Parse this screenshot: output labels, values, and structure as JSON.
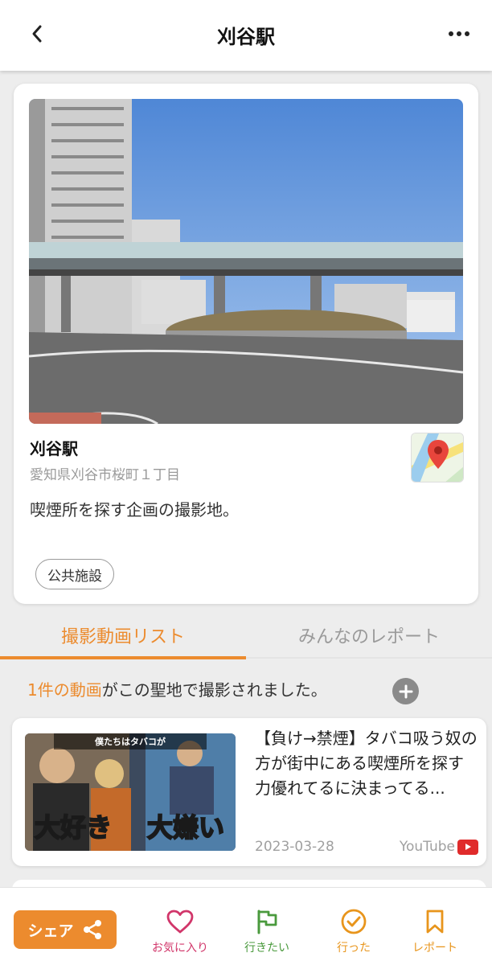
{
  "header": {
    "title": "刈谷駅",
    "back_icon": "chevron-left-icon",
    "more_icon": "more-horizontal-icon"
  },
  "spot": {
    "name": "刈谷駅",
    "address": "愛知県刈谷市桜町１丁目",
    "description": "喫煙所を探す企画の撮影地。",
    "category": "公共施設",
    "map_icon": "google-maps-icon"
  },
  "tabs": [
    {
      "label": "撮影動画リスト",
      "active": true
    },
    {
      "label": "みんなのレポート",
      "active": false
    }
  ],
  "video_list": {
    "count_text": "1件の動画",
    "suffix_text": "がこの聖地で撮影されました。",
    "add_icon": "plus-circle-icon",
    "videos": [
      {
        "title": "【負け→禁煙】タバコ吸う奴の方が街中にある喫煙所を探す力優れてるに決まってる...",
        "date": "2023-03-28",
        "source": "YouTube",
        "thumb_caption_top": "僕たちはタバコが",
        "thumb_caption_left": "大好き",
        "thumb_caption_right": "大嫌い"
      }
    ]
  },
  "bottom_bar": {
    "share_label": "シェア",
    "favorite_label": "お気に入り",
    "want_label": "行きたい",
    "went_label": "行った",
    "report_label": "レポート"
  },
  "colors": {
    "accent": "#ec8b2e",
    "favorite": "#d1366a",
    "want": "#4a9a3d",
    "went": "#e8951c"
  }
}
